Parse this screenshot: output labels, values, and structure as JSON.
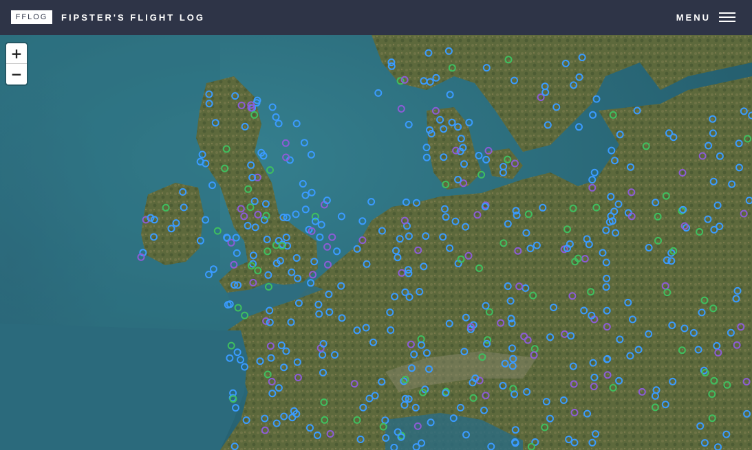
{
  "header": {
    "logo": "FFLOG",
    "title": "FIPSTER'S FLIGHT LOG",
    "menu_label": "MENU"
  },
  "zoom": {
    "in_label": "+",
    "out_label": "−"
  },
  "colors": {
    "header_bg": "#2e3447",
    "sea": "#2f6d7e",
    "land": "#5c6a3e",
    "marker_blue": "#3a9bff",
    "marker_green": "#3fbf5f",
    "marker_purple": "#8c5cd6"
  },
  "map": {
    "type": "satellite",
    "region": "Europe",
    "marker_style": "ring"
  }
}
